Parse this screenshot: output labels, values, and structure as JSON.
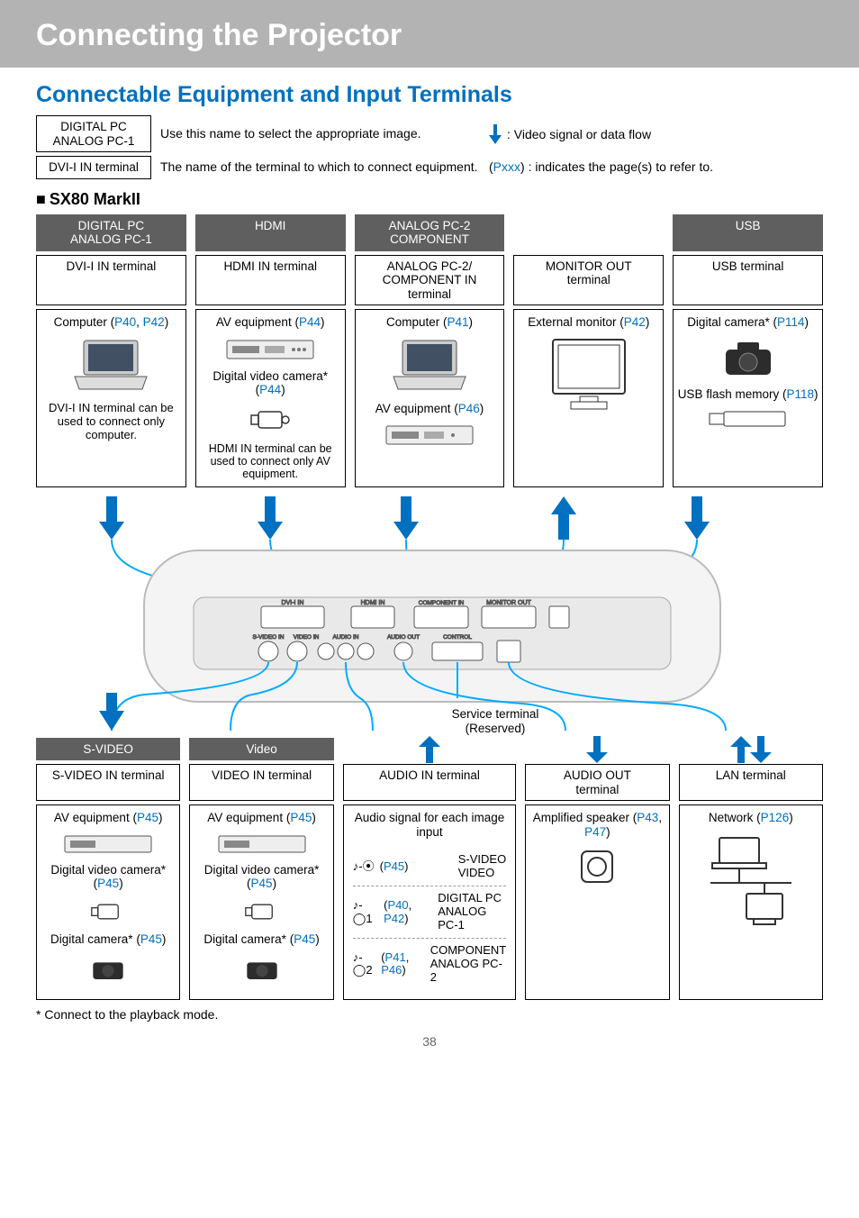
{
  "header": {
    "title": "Connecting the Projector"
  },
  "subtitle": "Connectable Equipment and Input Terminals",
  "legend": {
    "box1": "DIGITAL PC\nANALOG PC-1",
    "desc1": "Use this name to select the appropriate image.",
    "arrow_note": ": Video signal or data flow",
    "box2": "DVI-I IN terminal",
    "desc2": "The name of the terminal to which to connect equipment.",
    "pxxx_note_prefix": "(",
    "pxxx_note_link": "Pxxx",
    "pxxx_note_suffix": ") : indicates the page(s) to refer to."
  },
  "model": "SX80 MarkII",
  "top": {
    "darks": [
      "DIGITAL PC\nANALOG PC-1",
      "HDMI",
      "ANALOG PC-2\nCOMPONENT",
      "",
      "USB"
    ],
    "terms": [
      "DVI-I IN terminal",
      "HDMI IN terminal",
      "ANALOG PC-2/\nCOMPONENT IN\nterminal",
      "MONITOR OUT\nterminal",
      "USB terminal"
    ],
    "col1": {
      "a_prefix": "Computer (",
      "a_link1": "P40",
      "a_sep": ", ",
      "a_link2": "P42",
      "a_suffix": ")",
      "note": "DVI-I IN terminal can be used to connect only computer."
    },
    "col2": {
      "a_prefix": "AV equipment (",
      "a_link": "P44",
      "a_suffix": ")",
      "b_prefix": "Digital video camera* (",
      "b_link": "P44",
      "b_suffix": ")",
      "note": "HDMI IN terminal can be used to connect only AV equipment."
    },
    "col3": {
      "a_prefix": "Computer (",
      "a_link": "P41",
      "a_suffix": ")",
      "b_prefix": "AV equipment (",
      "b_link": "P46",
      "b_suffix": ")"
    },
    "col4": {
      "a_prefix": "External monitor (",
      "a_link": "P42",
      "a_suffix": ")"
    },
    "col5": {
      "a_prefix": "Digital camera* (",
      "a_link": "P114",
      "a_suffix": ")",
      "b_prefix": "USB flash memory (",
      "b_link": "P118",
      "b_suffix": ")"
    }
  },
  "service": "Service terminal\n(Reserved)",
  "bottom": {
    "darks": [
      "S-VIDEO",
      "Video",
      "",
      "",
      ""
    ],
    "terms": [
      "S-VIDEO IN terminal",
      "VIDEO IN terminal",
      "AUDIO IN terminal",
      "AUDIO OUT\nterminal",
      "LAN terminal"
    ],
    "col1": {
      "a_prefix": "AV equipment (",
      "a_link": "P45",
      "a_suffix": ")",
      "b_prefix": "Digital video camera* (",
      "b_link": "P45",
      "b_suffix": ")",
      "c_prefix": "Digital camera* (",
      "c_link": "P45",
      "c_suffix": ")"
    },
    "col2": {
      "a_prefix": "AV equipment (",
      "a_link": "P45",
      "a_suffix": ")",
      "b_prefix": "Digital video camera* (",
      "b_link": "P45",
      "b_suffix": ")",
      "c_prefix": "Digital camera* (",
      "c_link": "P45",
      "c_suffix": ")"
    },
    "col3": {
      "heading": "Audio signal for each image input",
      "row1_link": "P45",
      "row1_label": "S-VIDEO\nVIDEO",
      "row2_link1": "P40",
      "row2_link2": "P42",
      "row2_label": "DIGITAL PC\nANALOG PC-1",
      "row3_link1": "P41",
      "row3_link2": "P46",
      "row3_label": "COMPONENT\nANALOG PC-2"
    },
    "col4": {
      "a_prefix": "Amplified speaker (",
      "a_link1": "P43",
      "a_sep": ", ",
      "a_link2": "P47",
      "a_suffix": ")"
    },
    "col5": {
      "a_prefix": "Network (",
      "a_link": "P126",
      "a_suffix": ")"
    }
  },
  "footnote": "* Connect to the playback mode.",
  "pagenum": "38"
}
